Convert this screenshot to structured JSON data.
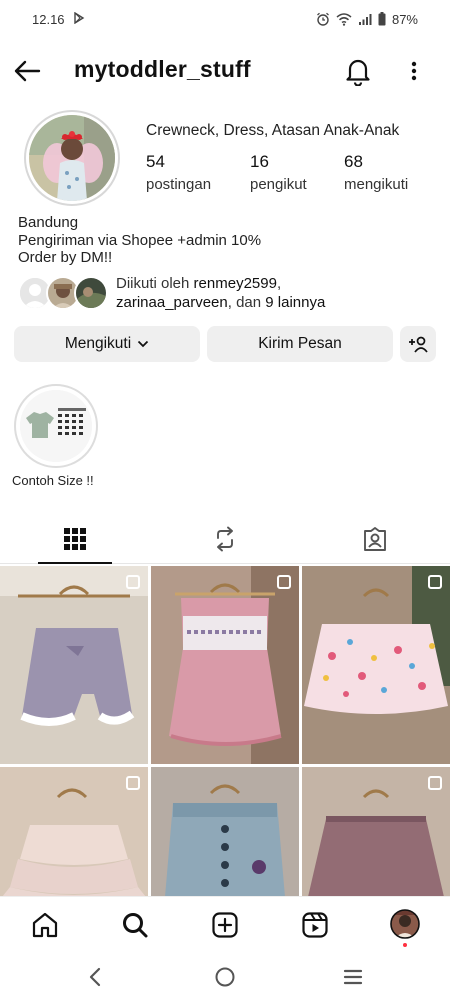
{
  "status_bar": {
    "time": "12.16",
    "battery": "87%"
  },
  "header": {
    "username": "mytoddler_stuff"
  },
  "profile": {
    "category": "Crewneck, Dress, Atasan Anak-Anak",
    "stats": [
      {
        "value": "54",
        "label": "postingan"
      },
      {
        "value": "16",
        "label": "pengikut"
      },
      {
        "value": "68",
        "label": "mengikuti"
      }
    ],
    "bio": [
      "Bandung",
      "Pengiriman via Shopee +admin 10%",
      "Order by DM!!"
    ],
    "followed_by": {
      "prefix": "Diikuti oleh ",
      "user1": "renmey2599",
      "comma": ",",
      "user2": "zarinaa_parveen",
      "middle": ", dan ",
      "others": "9 lainnya"
    }
  },
  "actions": {
    "following": "Mengikuti",
    "message": "Kirim Pesan"
  },
  "highlight": {
    "label": "Contoh Size !!"
  },
  "icons": {
    "back": "arrow-left-icon",
    "bell": "bell-icon",
    "more": "more-vertical-icon",
    "grid": "grid-icon",
    "reels": "reels-repost-icon",
    "tagged": "tagged-icon",
    "home": "home-icon",
    "search": "search-icon",
    "create": "plus-square-icon",
    "reels_nav": "reels-icon",
    "profile": "profile-avatar"
  },
  "colors": {
    "button_bg": "#efefef",
    "accent_notify": "#ff3040"
  }
}
